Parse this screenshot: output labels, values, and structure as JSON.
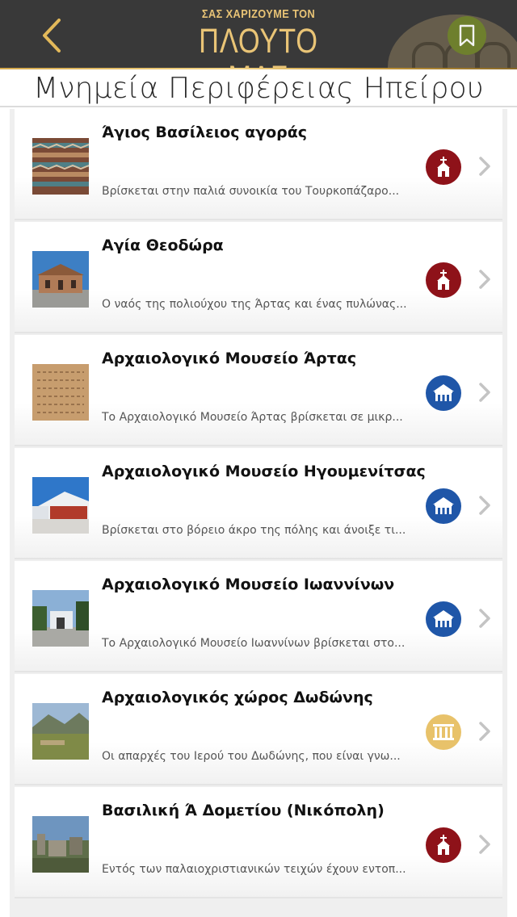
{
  "header": {
    "back_icon": "chevron-left-icon",
    "logo_line1": "ΣΑΣ ΧΑΡΙΖΟΥΜΕ ΤΟΝ",
    "logo_line2": "ΠΛΟΥΤΟ ΜΑΣ",
    "bookmark_icon": "bookmark-icon",
    "colors": {
      "bar": "#393939",
      "gold": "#e9c476",
      "bookmark": "#6e7f2d"
    }
  },
  "page": {
    "title": "Μνημεία Περιφέρειας Ηπείρου"
  },
  "categories": {
    "church": {
      "icon": "church-icon",
      "color": "#8e1219"
    },
    "museum": {
      "icon": "museum-icon",
      "color": "#1f56a8"
    },
    "site": {
      "icon": "columns-icon",
      "color": "#e8c26a"
    }
  },
  "items": [
    {
      "title": "Άγιος Βασίλειος αγοράς",
      "description": "Βρίσκεται στην παλιά συνοικία του Τουρκοπάζαρο...",
      "category": "church",
      "thumbnail": "brick-wall-photo"
    },
    {
      "title": "Αγία Θεοδώρα",
      "description": "Ο ναός της πολιούχου της Άρτας και ένας πυλώνας...",
      "category": "church",
      "thumbnail": "church-photo"
    },
    {
      "title": "Αρχαιολογικό Μουσείο Άρτας",
      "description": "Το Αρχαιολογικό Μουσείο Άρτας βρίσκεται σε μικρ...",
      "category": "museum",
      "thumbnail": "inscription-photo"
    },
    {
      "title": "Αρχαιολογικό Μουσείο Ηγουμενίτσας",
      "description": "Βρίσκεται στο βόρειο άκρο της πόλης και άνοιξε τι...",
      "category": "museum",
      "thumbnail": "modern-building-photo"
    },
    {
      "title": "Αρχαιολογικό Μουσείο Ιωαννίνων",
      "description": "Το Αρχαιολογικό Μουσείο Ιωαννίνων βρίσκεται στο...",
      "category": "museum",
      "thumbnail": "museum-courtyard-photo"
    },
    {
      "title": "Αρχαιολογικός χώρος Δωδώνης",
      "description": "Οι απαρχές του Ιερού του Δωδώνης, που είναι γνω...",
      "category": "site",
      "thumbnail": "landscape-photo"
    },
    {
      "title": "Βασιλική Ά Δομετίου (Νικόπολη)",
      "description": "Εντός των παλαιοχριστιανικών τειχών έχουν εντοπ...",
      "category": "church",
      "thumbnail": "ruins-photo"
    }
  ]
}
